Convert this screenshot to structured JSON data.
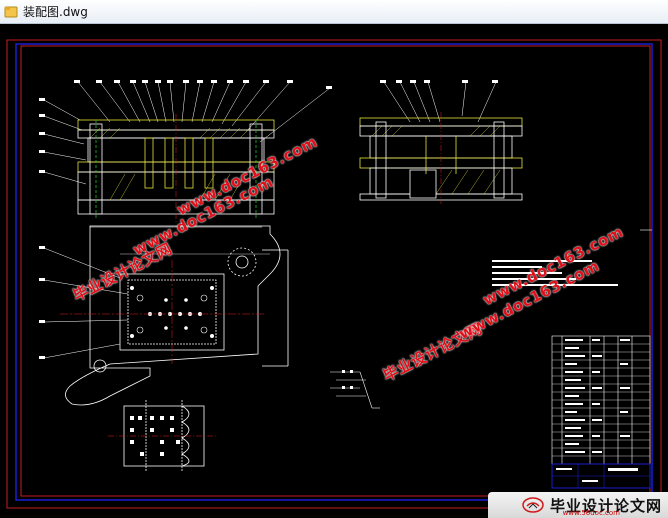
{
  "window": {
    "title": "装配图.dwg",
    "file_icon": "dwg-file-icon"
  },
  "watermarks": {
    "site_name": "毕业设计论文网",
    "site_url": "www.doc163.com"
  },
  "brand": {
    "name": "毕业设计论文网",
    "url": "www.56doc.com",
    "logo_icon": "book-logo-icon"
  },
  "colors": {
    "background": "#000000",
    "frame_red": "#c81e1e",
    "frame_blue": "#1c1cd2",
    "line_white": "#ffffff",
    "line_yellow": "#e8e23a",
    "line_red": "#e02020",
    "line_green": "#20c020",
    "watermark_red": "#e0101a"
  }
}
